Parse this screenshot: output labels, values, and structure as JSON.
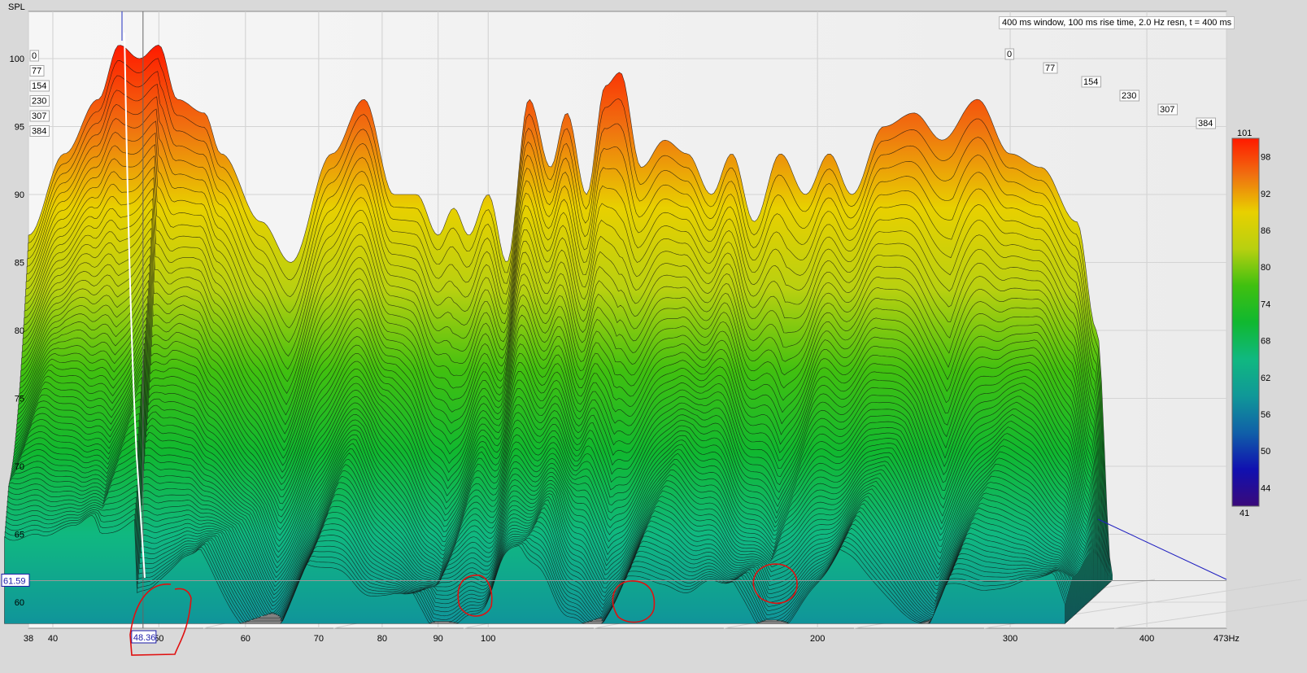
{
  "chart_data": {
    "type": "area",
    "subtype": "waterfall",
    "title": "400 ms window, 100 ms rise time,  2.0 Hz resn, t = 400 ms",
    "ylabel": "SPL",
    "xlabel": "Hz",
    "x_scale": "log",
    "xlim": [
      38,
      473
    ],
    "ylim": [
      58,
      103
    ],
    "grid": true,
    "x_ticks": [
      "38",
      "40",
      "50",
      "60",
      "70",
      "80",
      "90",
      "100",
      "200",
      "300",
      "400",
      "473Hz"
    ],
    "x_tick_values": [
      38,
      40,
      50,
      60,
      70,
      80,
      90,
      100,
      200,
      300,
      400,
      473
    ],
    "y_ticks": [
      60,
      65,
      70,
      75,
      80,
      85,
      90,
      95,
      100
    ],
    "time_ticks_ms": [
      "0",
      "77",
      "154",
      "230",
      "307",
      "384"
    ],
    "time_range_ms": [
      0,
      400
    ],
    "series": [
      {
        "name": "t = 0 ms",
        "x": [
          38,
          41,
          44,
          46,
          48,
          50,
          52,
          55,
          57,
          62,
          66,
          72,
          77,
          82,
          86,
          90,
          93,
          96,
          100,
          104,
          109,
          114,
          118,
          123,
          128,
          132,
          138,
          145,
          152,
          160,
          167,
          175,
          185,
          195,
          205,
          215,
          230,
          245,
          260,
          280,
          300,
          320,
          345,
          360,
          372
        ],
        "y": [
          87,
          93,
          97,
          101,
          100,
          101,
          97,
          96,
          93,
          88,
          85,
          93,
          97,
          90,
          90,
          87,
          89,
          87,
          90,
          85,
          97,
          92,
          96,
          90,
          98,
          99,
          92,
          94,
          93,
          90,
          93,
          88,
          93,
          90,
          93,
          90,
          95,
          96,
          94,
          97,
          93,
          92,
          88,
          80,
          62
        ]
      }
    ],
    "colorbar": {
      "max_label": "101",
      "min_label": "41",
      "ticks": [
        "98",
        "92",
        "86",
        "80",
        "74",
        "68",
        "62",
        "56",
        "50",
        "44"
      ],
      "stops": [
        {
          "value": 101,
          "color": "#ff1a00"
        },
        {
          "value": 95,
          "color": "#f07010"
        },
        {
          "value": 89,
          "color": "#e8d000"
        },
        {
          "value": 83,
          "color": "#b8d010"
        },
        {
          "value": 77,
          "color": "#40c010"
        },
        {
          "value": 71,
          "color": "#10b830"
        },
        {
          "value": 65,
          "color": "#10b880"
        },
        {
          "value": 59,
          "color": "#109898"
        },
        {
          "value": 53,
          "color": "#1060a8"
        },
        {
          "value": 47,
          "color": "#1010b0"
        },
        {
          "value": 41,
          "color": "#3a0a7a"
        }
      ]
    },
    "cursor": {
      "x_value": "48.36",
      "y_value": "61.59",
      "color": "#1a1aa8"
    }
  },
  "ui": {
    "annotation_color": "#e01010",
    "background": "#d9d9d9",
    "plot_bg": "#f4f4f4"
  }
}
